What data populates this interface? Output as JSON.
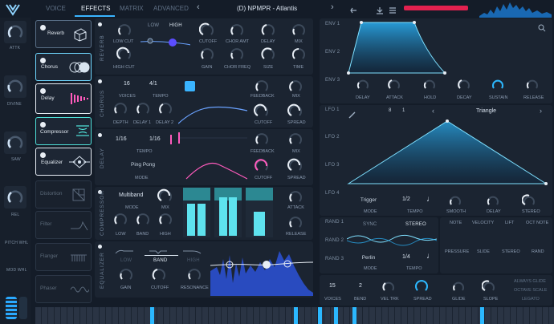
{
  "header": {
    "tabs": [
      "VOICE",
      "EFFECTS",
      "MATRIX",
      "ADVANCED"
    ],
    "active_tab": "EFFECTS",
    "preset": "(D) NPMPR - Atlantis",
    "prev": "‹",
    "next": "›"
  },
  "left": {
    "labels": [
      "ATTK",
      "DIVINE",
      "SAW",
      "REL",
      "PITCH WHL",
      "MOD WHL"
    ]
  },
  "effects": [
    {
      "name": "Reverb",
      "on": true
    },
    {
      "name": "Chorus",
      "on": true
    },
    {
      "name": "Delay",
      "on": true
    },
    {
      "name": "Compressor",
      "on": true
    },
    {
      "name": "Equalizer",
      "on": true
    },
    {
      "name": "Distortion",
      "on": false
    },
    {
      "name": "Filter",
      "on": false
    },
    {
      "name": "Flanger",
      "on": false
    },
    {
      "name": "Phaser",
      "on": false
    }
  ],
  "reverb": {
    "section": "REVERB",
    "low": "LOW",
    "high": "HIGH",
    "k1": "LOW CUT",
    "k2": "HIGH CUT",
    "k3": "CUTOFF",
    "k4": "CHOR AMT",
    "k5": "DELAY",
    "k6": "MIX",
    "k7": "GAIN",
    "k8": "CHOR FREQ",
    "k9": "SIZE",
    "k10": "TIME"
  },
  "chorus": {
    "section": "CHORUS",
    "voices": "16",
    "tempo": "4/1",
    "l_voices": "VOICES",
    "l_tempo": "TEMPO",
    "l_feedback": "FEEDBACK",
    "l_mix": "MIX",
    "l_depth": "DEPTH",
    "l_d1": "DELAY 1",
    "l_d2": "DELAY 2",
    "l_cutoff": "CUTOFF",
    "l_spread": "SPREAD"
  },
  "delay": {
    "section": "DELAY",
    "t1": "1/16",
    "t2": "1/16",
    "l_tempo": "TEMPO",
    "mode": "Ping Pong",
    "l_mode": "MODE",
    "l_feedback": "FEEDBACK",
    "l_mix": "MIX",
    "l_cutoff": "CUTOFF",
    "l_spread": "SPREAD"
  },
  "compressor": {
    "section": "COMPRESSOR",
    "mode": "Multiband",
    "l_mode": "MODE",
    "l_mix": "MIX",
    "l_low": "LOW",
    "l_band": "BAND",
    "l_high": "HIGH",
    "l_attack": "ATTACK",
    "l_release": "RELEASE"
  },
  "equalizer": {
    "section": "EQUALIZER",
    "low": "LOW",
    "band": "BAND",
    "high": "HIGH",
    "l_gain": "GAIN",
    "l_cutoff": "CUTOFF",
    "l_res": "RESONANCE"
  },
  "env": {
    "rows": [
      "ENV 1",
      "ENV 2",
      "ENV 3"
    ],
    "knobs": [
      "DELAY",
      "ATTACK",
      "HOLD",
      "DECAY",
      "SUSTAIN",
      "RELEASE"
    ]
  },
  "lfo": {
    "rows": [
      "LFO 1",
      "LFO 2",
      "LFO 3",
      "LFO 4"
    ],
    "grid1": "8",
    "grid2": "1",
    "shape": "Triangle",
    "trigger": "Trigger",
    "tempo": "1/2",
    "l_mode": "MODE",
    "l_tempo": "TEMPO",
    "l_smooth": "SMOOTH",
    "l_delay": "DELAY",
    "l_stereo": "STEREO"
  },
  "rand": {
    "rows": [
      "RAND 1",
      "RAND 2",
      "RAND 3"
    ],
    "sync": "SYNC",
    "stereo": "STEREO",
    "mode": "Perlin",
    "tempo": "1/4",
    "l_mode": "MODE",
    "l_tempo": "TEMPO"
  },
  "mods": {
    "top": [
      "NOTE",
      "VELOCITY",
      "LIFT",
      "OCT NOTE"
    ],
    "bottom": [
      "PRESSURE",
      "SLIDE",
      "STEREO",
      "RAND"
    ]
  },
  "voice": {
    "voices": "15",
    "bend": "2",
    "l_voices": "VOICES",
    "l_bend": "BEND",
    "l_vel": "VEL TRK",
    "l_spread": "SPREAD",
    "l_glide": "GLIDE",
    "l_slope": "SLOPE",
    "opts": [
      "ALWAYS GLIDE",
      "OCTAVE SCALE",
      "LEGATO"
    ]
  }
}
